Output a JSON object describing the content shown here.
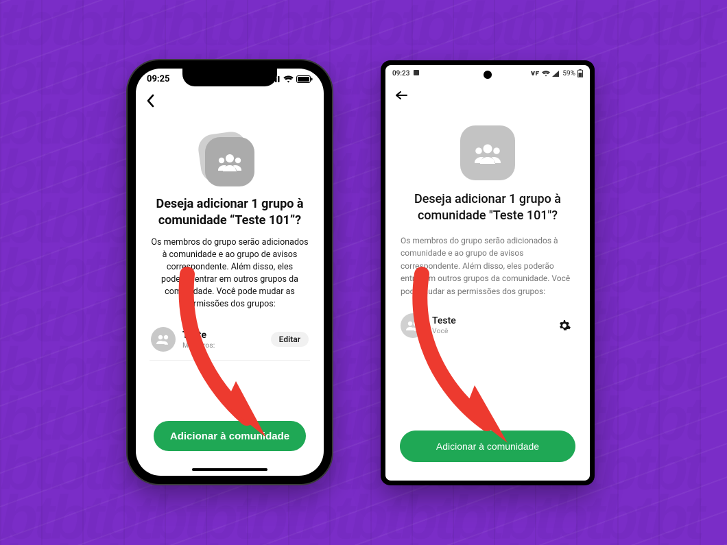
{
  "background": {
    "pattern_text": "tbtbtbtbtbtbtbtbtbtbtbtbtbtbtbtbtbtbtbtbtbtbtbtbtbtbtbtbtbtbtbtbtbtbtbtbtbtbtbtbtbtbtbtbtbtbtbtbtbtbtbtbtbtbtbtbtbtbtbtbtbtbtbtbtbtbtbtbtbtbtbtbtbtbtbtbtbtbtbtbtbtbtbtbtbtbtbtbtbtbtbtbtbtbtbtbtbtbtbtbtbtbtbtbtbtbtbtbtbtbtbtbtbtbtbtbtbtbtbtbtbtbtbtbtbtbtbtbtbtbtbtbtbtbtbtbtbtbtbtbtbtbtbtbtbtbtbtbtbtbtbtbtbtbtbtbtbtbtbtbtbtbtbtbtbtbtbtbtbtbtbtbtbtbtbtbtbtbtbtbtbtbtbtbtbtbtbtbtbtbtbtbtbtbtbtbtbtbtbtbtbtbtbtbtbtbtbtbtbtbtbtbtbtbtbtbtbtbtbtbtbtbtbtbtbtbtbtbtbtbtbtbtbtbtbtbtbtbtbtbtbtbtbtbtbtbtbtbtbtbtbtbtbtbtbtbtbtbtbtbtbtbtbtbtbtbtbtbtbtbtbtbtbtbtbtbtbtbtbtbtbtbtbtbtbtbtbtbtbtbtbtbtbtbtbtbtbtbtbtbtbtbtbtbtbtbtbtbtbtbtbtbtbtbtbtbtbtbtbtbtbtbtbtbtbtbtbtbtbtbtbtbtbtbtbtbtbtbtbtbtbtbtbtbtbtbtbtbtbtbtbtbtbtbtbtbtbtbtbtbtbtbtbtbtbtbtbtbtbtbtbtbtbtbtbtbtbtbtbtbtbtbtbtbtbtbtbtbtbtbtbtbtbtbtbtbtbtbtbtbtbtbtbtbtbtbtbtbtbtbtb"
  },
  "colors": {
    "background": "#7A2DC7",
    "cta": "#1FA855",
    "arrow": "#ED3A2F"
  },
  "ios": {
    "status": {
      "time": "09:25"
    },
    "title": "Deseja adicionar 1 grupo à comunidade “Teste 101”?",
    "paragraph": "Os membros do grupo serão adicionados à comunidade e ao grupo de avisos correspondente. Além disso, eles poderão entrar em outros grupos da comunidade. Você pode mudar as permissões dos grupos:",
    "group": {
      "name": "Teste",
      "subtitle": "Membros:",
      "edit_label": "Editar"
    },
    "cta_label": "Adicionar à comunidade"
  },
  "android": {
    "status": {
      "time": "09:23",
      "battery_text": "59%"
    },
    "title": "Deseja adicionar 1 grupo à comunidade \"Teste 101\"?",
    "paragraph": "Os membros do grupo serão adicionados à comunidade e ao grupo de avisos correspondente. Além disso, eles poderão entrar em outros grupos da comunidade. Você pode mudar as permissões dos grupos:",
    "group": {
      "name": "Teste",
      "subtitle": "Você"
    },
    "cta_label": "Adicionar à comunidade"
  }
}
